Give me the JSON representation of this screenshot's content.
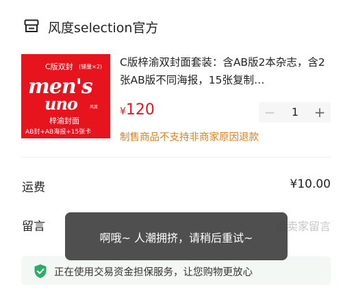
{
  "store": {
    "icon": "store-icon",
    "name": "风度selection官方"
  },
  "product": {
    "thumbnail": {
      "edition": "C版双封",
      "edition_note": "(铺量×2)",
      "logo_line1": "men's",
      "logo_line2": "uno",
      "logo_small": "风度",
      "subtitle": "梓渝封面",
      "bottom_line": "AB封+AB海报+15张卡",
      "background_color": "#e8141d"
    },
    "title": "C版梓渝双封面套装：含AB版2本杂志，含2张AB版不同海报，15张复制…",
    "price_currency": "¥",
    "price_value": "120",
    "price_color": "#e8141d",
    "quantity": "1",
    "minus_label": "−",
    "plus_label": "+",
    "return_note": "制售商品不支持非商家原因退款",
    "return_note_color": "#d9821e"
  },
  "shipping": {
    "label": "运费",
    "value": "¥10.00"
  },
  "message": {
    "label": "留言",
    "placeholder": "给卖家留言"
  },
  "guarantee": {
    "icon": "shield-check-icon",
    "text": "正在使用交易资金担保服务，让您购物更放心",
    "icon_color": "#2aae67"
  },
  "toast": {
    "message": "啊哦~ 人潮拥挤，请稍后重试~"
  }
}
